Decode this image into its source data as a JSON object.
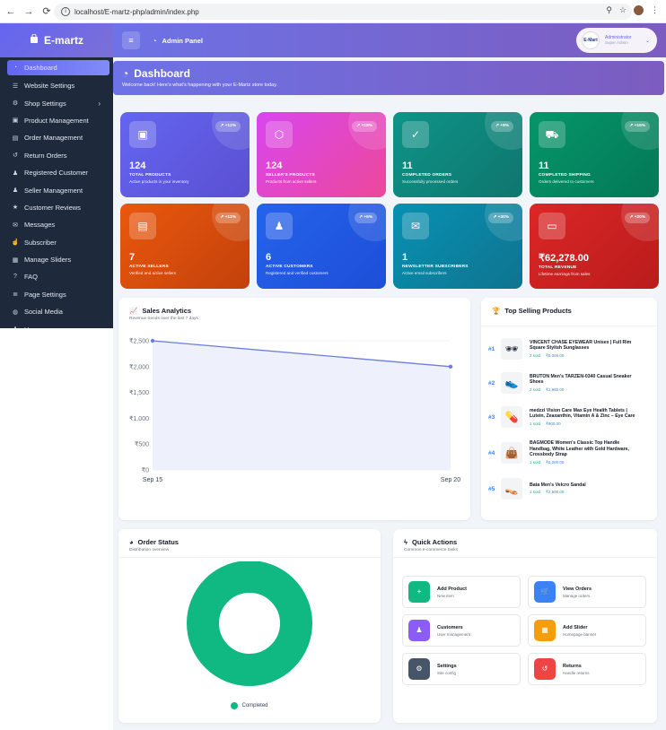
{
  "browser": {
    "url": "localhost/E-martz-php/admin/index.php"
  },
  "sidebar": {
    "brand": "E-martz",
    "items": [
      {
        "label": "Dashboard",
        "icon": "dashboard-icon"
      },
      {
        "label": "Website Settings",
        "icon": "sliders-icon"
      },
      {
        "label": "Shop Settings",
        "icon": "gears-icon"
      },
      {
        "label": "Product Management",
        "icon": "bag-icon"
      },
      {
        "label": "Order Management",
        "icon": "clipboard-icon"
      },
      {
        "label": "Return Orders",
        "icon": "undo-icon"
      },
      {
        "label": "Registered Customer",
        "icon": "user-plus-icon"
      },
      {
        "label": "Seller Management",
        "icon": "user-tie-icon"
      },
      {
        "label": "Customer Reviews",
        "icon": "star-icon"
      },
      {
        "label": "Messages",
        "icon": "envelope-icon"
      },
      {
        "label": "Subscriber",
        "icon": "thumbs-up-icon"
      },
      {
        "label": "Manage Sliders",
        "icon": "images-icon"
      },
      {
        "label": "FAQ",
        "icon": "question-icon"
      },
      {
        "label": "Page Settings",
        "icon": "list-icon"
      },
      {
        "label": "Social Media",
        "icon": "globe-icon"
      },
      {
        "label": "Users",
        "icon": "users-icon"
      }
    ]
  },
  "topbar": {
    "title": "Admin Panel",
    "user_name": "Administrator",
    "user_role": "Super Admin",
    "logo_text": "E-Mart"
  },
  "banner": {
    "title": "Dashboard",
    "subtitle": "Welcome back! Here's what's happening with your E-Martz store today."
  },
  "stats": [
    {
      "value": "124",
      "label": "TOTAL PRODUCTS",
      "desc": "Active products in your inventory",
      "badge": "+12%",
      "icon": "box-icon",
      "color1": "#6366f1",
      "color2": "#5b4fd1"
    },
    {
      "value": "124",
      "label": "SELLER'S PRODUCTS",
      "desc": "Products from active sellers",
      "badge": "+18%",
      "icon": "cube-icon",
      "color1": "#d946ef",
      "color2": "#ec4899"
    },
    {
      "value": "11",
      "label": "COMPLETED ORDERS",
      "desc": "Successfully processed orders",
      "badge": "+8%",
      "icon": "check-icon",
      "color1": "#0d9488",
      "color2": "#0f766e"
    },
    {
      "value": "11",
      "label": "COMPLETED SHIPPING",
      "desc": "Orders delivered to customers",
      "badge": "+15%",
      "icon": "truck-icon",
      "color1": "#059669",
      "color2": "#047857"
    },
    {
      "value": "7",
      "label": "ACTIVE SELLERS",
      "desc": "Verified and active sellers",
      "badge": "+12%",
      "icon": "store-icon",
      "color1": "#ea580c",
      "color2": "#c2410c"
    },
    {
      "value": "6",
      "label": "ACTIVE CUSTOMERS",
      "desc": "Registered and verified customers",
      "badge": "+5%",
      "icon": "users-icon",
      "color1": "#2563eb",
      "color2": "#1d4ed8"
    },
    {
      "value": "1",
      "label": "NEWSLETTER SUBSCRIBERS",
      "desc": "Active email subscribers",
      "badge": "+30%",
      "icon": "envelope-icon",
      "color1": "#0891b2",
      "color2": "#0e7490"
    },
    {
      "value": "₹62,278.00",
      "label": "TOTAL REVENUE",
      "desc": "Lifetime earnings from sales",
      "badge": "+20%",
      "icon": "money-icon",
      "color1": "#dc2626",
      "color2": "#b91c1c"
    }
  ],
  "sales": {
    "title": "Sales Analytics",
    "subtitle": "Revenue trends over the last 7 days"
  },
  "chart_data": {
    "type": "line",
    "x": [
      "Sep 15",
      "Sep 20"
    ],
    "series": [
      {
        "values": [
          2500,
          2000
        ]
      }
    ],
    "yticks": [
      "₹0",
      "₹500",
      "₹1,000",
      "₹1,500",
      "₹2,000",
      "₹2,500"
    ],
    "ylim": [
      0,
      2500
    ],
    "line_color": "#6b7fe0",
    "fill_color": "#eef0fb",
    "grid": true
  },
  "top_selling": {
    "title": "Top Selling Products",
    "items": [
      {
        "rank": "#1",
        "name": "VINCENT CHASE EYEWEAR Unisex | Full Rim Square Stylish Sunglasses",
        "sold": "2 sold",
        "price": "₹5,000.00",
        "icon": "sunglasses-icon"
      },
      {
        "rank": "#2",
        "name": "BRUTON Men's TARZEN-0340 Casual Sneaker Shoes",
        "sold": "2 sold",
        "price": "₹1,980.00",
        "icon": "sneaker-icon"
      },
      {
        "rank": "#3",
        "name": "medzzi Vision Care Max Eye Health Tablets | Lutein, Zeaxanthin, Vitamin A & Zinc – Eye Care",
        "sold": "1 sold",
        "price": "₹900.00",
        "icon": "bottle-icon"
      },
      {
        "rank": "#4",
        "name": "BAGMODE Women's Classic Top Handle Handbag, White Leather with Gold Hardware, Crossbody Strap",
        "sold": "1 sold",
        "price": "₹5,000.00",
        "icon": "handbag-icon"
      },
      {
        "rank": "#5",
        "name": "Bata Men's Velcro Sandal",
        "sold": "1 sold",
        "price": "₹2,500.00",
        "icon": "sandal-icon"
      }
    ]
  },
  "order_status": {
    "title": "Order Status",
    "subtitle": "Distribution overview",
    "legend": "Completed",
    "color": "#10b981",
    "completed_share": 1
  },
  "quick_actions": {
    "title": "Quick Actions",
    "subtitle": "Common e-commerce tasks",
    "items": [
      {
        "label": "Add Product",
        "sub": "New item",
        "icon": "plus-icon",
        "color": "#10b981"
      },
      {
        "label": "View Orders",
        "sub": "Manage orders",
        "icon": "cart-icon",
        "color": "#3b82f6"
      },
      {
        "label": "Customers",
        "sub": "User management",
        "icon": "users-icon",
        "color": "#8b5cf6"
      },
      {
        "label": "Add Slider",
        "sub": "Homepage banner",
        "icon": "image-icon",
        "color": "#f59e0b"
      },
      {
        "label": "Settings",
        "sub": "Site config",
        "icon": "gear-icon",
        "color": "#475569"
      },
      {
        "label": "Returns",
        "sub": "Handle returns",
        "icon": "undo-icon",
        "color": "#ef4444"
      }
    ]
  }
}
